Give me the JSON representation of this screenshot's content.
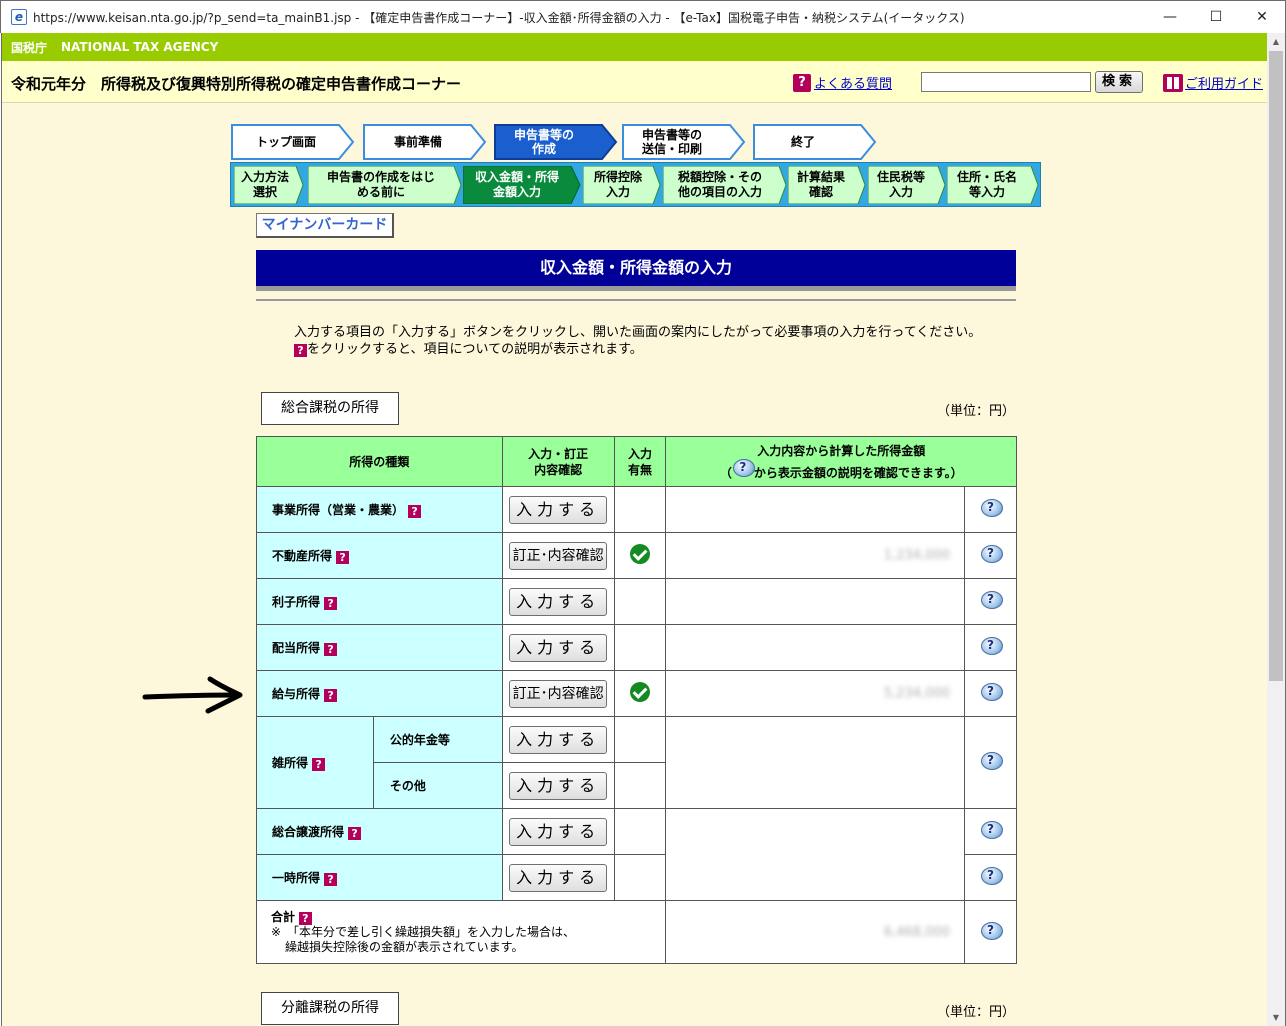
{
  "window": {
    "title": "https://www.keisan.nta.go.jp/?p_send=ta_mainB1.jsp - 【確定申告書作成コーナー】-収入金額･所得金額の入力 - 【e-Tax】国税電子申告・納税システム(イータックス)",
    "minimize": "—",
    "maximize": "☐",
    "close": "✕"
  },
  "agency": {
    "jp": "国税庁",
    "en": "NATIONAL TAX AGENCY"
  },
  "header": {
    "title": "令和元年分　所得税及び復興特別所得税の確定申告書作成コーナー",
    "faq_label": "よくある質問",
    "search_value": "",
    "search_button": "検索",
    "guide_label": "ご利用ガイド"
  },
  "main_steps": [
    {
      "line1": "トップ画面",
      "line2": ""
    },
    {
      "line1": "事前準備",
      "line2": ""
    },
    {
      "line1": "申告書等の",
      "line2": "作成"
    },
    {
      "line1": "申告書等の",
      "line2": "送信・印刷"
    },
    {
      "line1": "終了",
      "line2": ""
    }
  ],
  "sub_steps": [
    {
      "line1": "入力方法",
      "line2": "選択"
    },
    {
      "line1": "申告書の作成をはじ",
      "line2": "める前に"
    },
    {
      "line1": "収入金額・所得",
      "line2": "金額入力"
    },
    {
      "line1": "所得控除",
      "line2": "入力"
    },
    {
      "line1": "税額控除・その",
      "line2": "他の項目の入力"
    },
    {
      "line1": "計算結果",
      "line2": "確認"
    },
    {
      "line1": "住民税等",
      "line2": "入力"
    },
    {
      "line1": "住所・氏名",
      "line2": "等入力"
    }
  ],
  "mynumber_label": "マイナンバーカード",
  "page_title": "収入金額・所得金額の入力",
  "instructions": {
    "line1": "入力する項目の「入力する」ボタンをクリックし、開いた画面の案内にしたがって必要事項の入力を行ってください。",
    "line2_suffix": "をクリックすると、項目についての説明が表示されます。"
  },
  "sections": {
    "general": "総合課税の所得",
    "separate": "分離課税の所得",
    "unit": "（単位：円）"
  },
  "table": {
    "headers": {
      "kind": "所得の種類",
      "action_l1": "入力・訂正",
      "action_l2": "内容確認",
      "status_l1": "入力",
      "status_l2": "有無",
      "amount_l1": "入力内容から計算した所得金額",
      "amount_l2_pre": "（",
      "amount_l2_post": "から表示金額の説明を確認できます。）"
    },
    "rows": {
      "business": {
        "label": "事業所得（営業・農業）",
        "button": "入力する",
        "amount": ""
      },
      "real_estate": {
        "label": "不動産所得",
        "button": "訂正･内容確認",
        "amount": "1,234,000"
      },
      "interest": {
        "label": "利子所得",
        "button": "入力する",
        "amount": ""
      },
      "dividend": {
        "label": "配当所得",
        "button": "入力する",
        "amount": ""
      },
      "salary": {
        "label": "給与所得",
        "button": "訂正･内容確認",
        "amount": "5,234,000"
      },
      "misc": {
        "label": "雑所得",
        "pension_label": "公的年金等",
        "other_label": "その他",
        "button": "入力する"
      },
      "capital_gain": {
        "label": "総合譲渡所得",
        "button": "入力する"
      },
      "temporary": {
        "label": "一時所得",
        "button": "入力する"
      },
      "total": {
        "label": "合計",
        "note1": "※　「本年分で差し引く繰越損失額」を入力した場合は、",
        "note2": "繰越損失控除後の金額が表示されています。",
        "amount": "6,468,000"
      }
    },
    "help_glyph": "?",
    "q_glyph": "?"
  }
}
